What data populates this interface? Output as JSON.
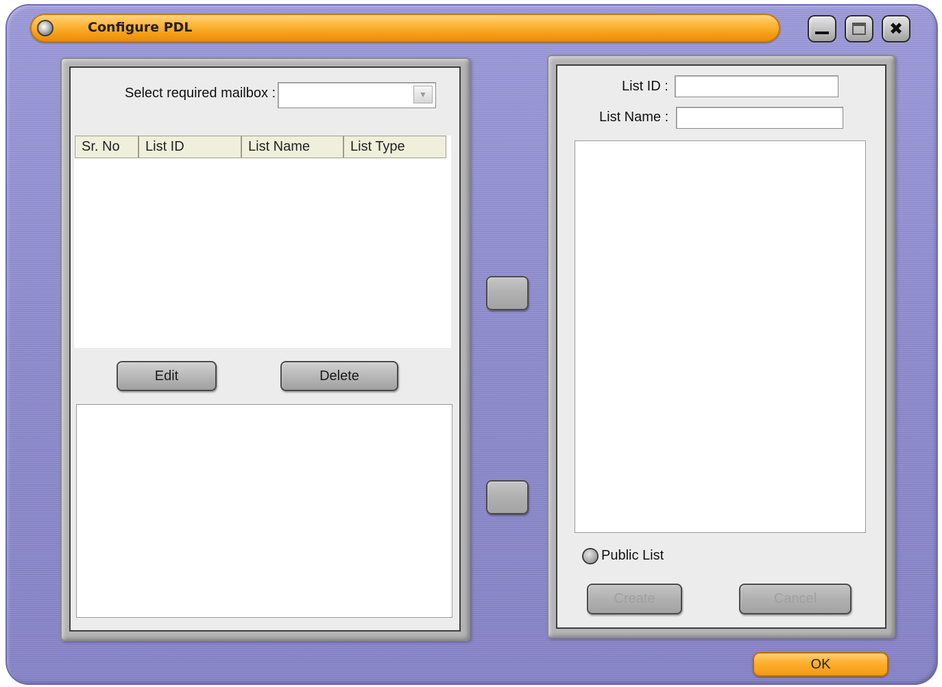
{
  "window": {
    "title": "Configure PDL",
    "controls": {
      "minimize_icon": "minimize-icon",
      "maximize_icon": "maximize-icon",
      "close_icon": "close-icon"
    },
    "title_color": "#f6a21c",
    "frame_color": "#8f8bd0"
  },
  "left_panel": {
    "mailbox_label": "Select required mailbox :",
    "mailbox_value": "",
    "table": {
      "columns": [
        "Sr. No",
        "List ID",
        "List Name",
        "List Type"
      ],
      "rows": []
    },
    "edit_label": "Edit",
    "delete_label": "Delete"
  },
  "middle": {
    "add_label": "",
    "remove_label": ""
  },
  "right_panel": {
    "list_id_label": "List ID :",
    "list_id_value": "",
    "list_name_label": "List Name :",
    "list_name_value": "",
    "public_list_label": "Public List",
    "public_list_checked": false,
    "create_label": "Create",
    "cancel_label": "Cancel"
  },
  "footer": {
    "ok_label": "OK"
  }
}
